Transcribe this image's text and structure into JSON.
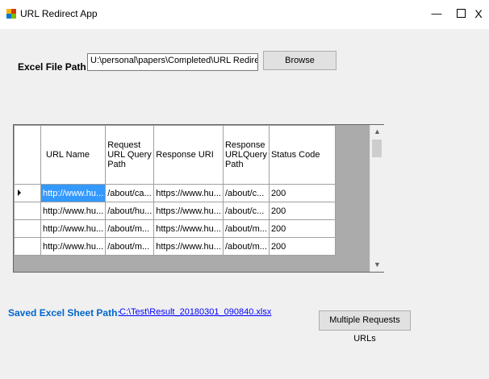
{
  "window": {
    "title": "URL Redirect App",
    "minimize_glyph": "—",
    "close_glyph": "X"
  },
  "form": {
    "excel_label": "Excel File Path",
    "excel_path_value": "U:\\personal\\papers\\Completed\\URL Redirects and I",
    "browse_label": "Browse",
    "saved_label": "Saved Excel Sheet Path:",
    "saved_path": "C:\\Test\\Result_20180301_090840.xlsx",
    "multi_button_label": "Multiple Requests URLs"
  },
  "grid": {
    "columns": [
      "URL Name",
      "Request URL Query Path",
      "Response URI",
      "Response URLQuery Path",
      "Status Code"
    ],
    "rows": [
      [
        "http://www.hu...",
        "/about/ca...",
        "https://www.hu...",
        "/about/c...",
        "200"
      ],
      [
        "http://www.hu...",
        "/about/hu...",
        "https://www.hu...",
        "/about/c...",
        "200"
      ],
      [
        "http://www.hu...",
        "/about/m...",
        "https://www.hu...",
        "/about/m...",
        "200"
      ],
      [
        "http://www.hu...",
        "/about/m...",
        "https://www.hu...",
        "/about/m...",
        "200"
      ]
    ],
    "selected_row": 0
  },
  "colors": {
    "selection": "#3399ff",
    "saved_label": "#0066cc",
    "link": "#0000ff",
    "grid_background": "#ababab"
  }
}
